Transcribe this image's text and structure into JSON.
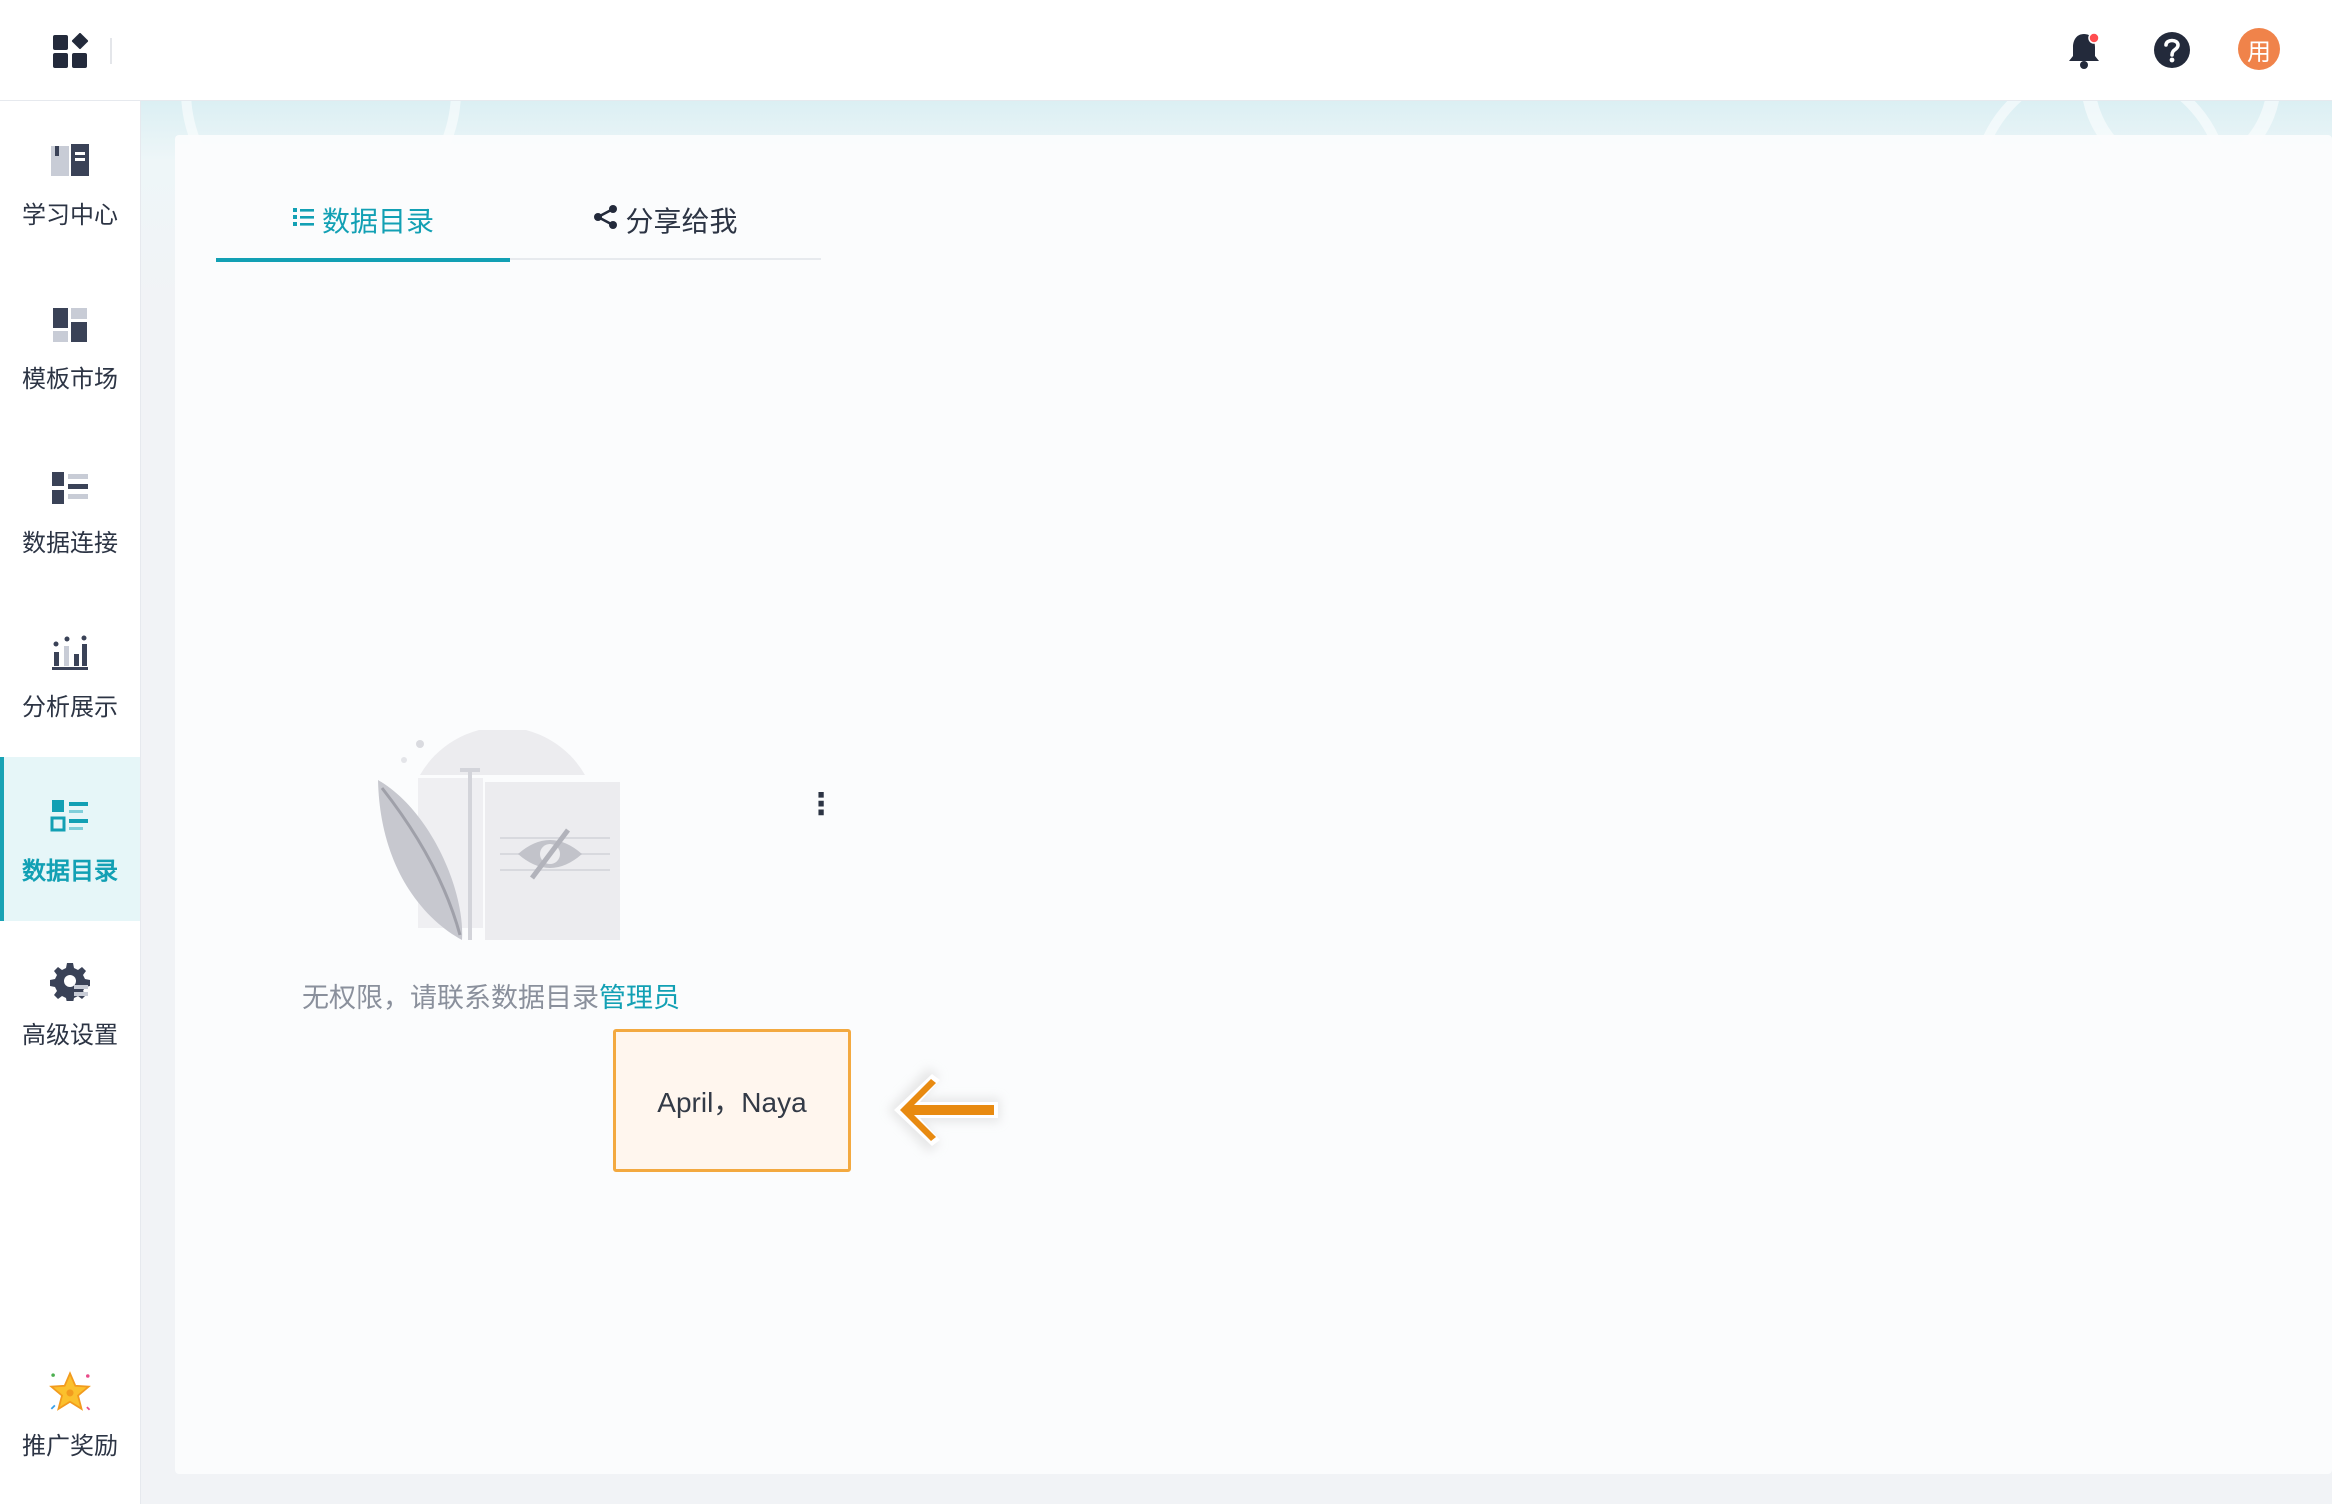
{
  "header": {
    "apps_icon": "apps-grid-icon",
    "notification_icon": "bell-icon",
    "help_icon": "help-circle-icon",
    "avatar_text": "用",
    "avatar_color": "#f0834a"
  },
  "sidebar": {
    "accent_color": "#12a0b4",
    "items": [
      {
        "label": "学习中心",
        "icon": "book-icon"
      },
      {
        "label": "模板市场",
        "icon": "template-icon"
      },
      {
        "label": "数据连接",
        "icon": "data-connection-icon"
      },
      {
        "label": "分析展示",
        "icon": "analysis-chart-icon"
      },
      {
        "label": "数据目录",
        "icon": "data-catalog-icon",
        "active": true
      },
      {
        "label": "高级设置",
        "icon": "gear-icon"
      },
      {
        "label": "推广奖励",
        "icon": "star-reward-icon"
      }
    ]
  },
  "tabs": [
    {
      "label": "数据目录",
      "icon": "list-icon",
      "active": true
    },
    {
      "label": "分享给我",
      "icon": "share-icon",
      "active": false
    }
  ],
  "empty_state": {
    "illustration": "no-permission-illustration",
    "message": "无权限，请联系数据目录",
    "link_text": "管理员"
  },
  "admin_popup": {
    "names": "April，Naya"
  },
  "annotation": {
    "arrow_icon": "arrow-left-icon",
    "arrow_color": "#e88a10"
  }
}
